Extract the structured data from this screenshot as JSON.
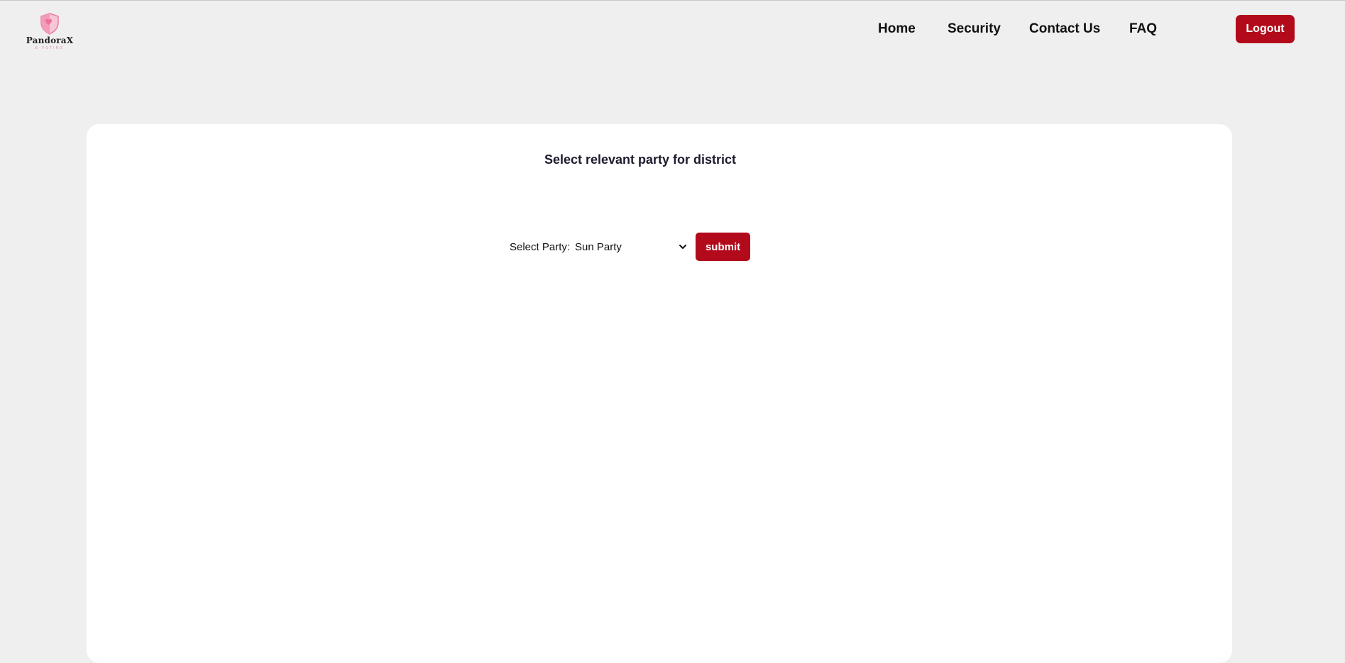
{
  "header": {
    "logo": {
      "name": "PandoraX",
      "tagline": "E-VOTING",
      "icon": "shield-icon"
    },
    "nav": [
      {
        "label": "Home"
      },
      {
        "label": "Security"
      },
      {
        "label": "Contact Us"
      },
      {
        "label": "FAQ"
      }
    ],
    "logout_label": "Logout"
  },
  "main": {
    "title": "Select relevant party for district",
    "form": {
      "select_label": "Select Party:",
      "selected_party": "Sun Party",
      "submit_label": "submit"
    }
  },
  "colors": {
    "accent": "#b30a1b",
    "background": "#efefef",
    "card": "#ffffff",
    "logo_pink": "#f2a3bf"
  }
}
